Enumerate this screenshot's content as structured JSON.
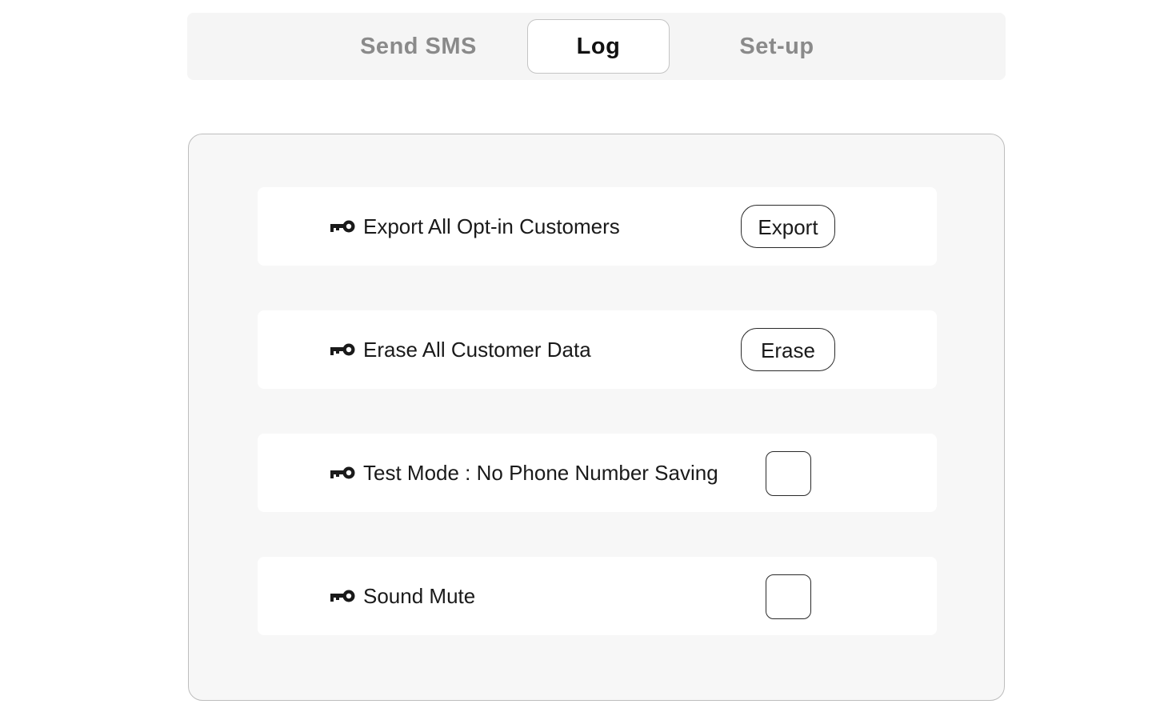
{
  "tabs": [
    {
      "label": "Send SMS",
      "active": false
    },
    {
      "label": "Log",
      "active": true
    },
    {
      "label": "Set-up",
      "active": false
    }
  ],
  "settings": {
    "rows": [
      {
        "icon": "key-icon",
        "label": "Export All Opt-in Customers",
        "control": "button",
        "button_label": "Export"
      },
      {
        "icon": "key-icon",
        "label": "Erase All Customer Data",
        "control": "button",
        "button_label": "Erase"
      },
      {
        "icon": "key-icon",
        "label": "Test Mode : No Phone Number Saving",
        "control": "checkbox",
        "checked": false
      },
      {
        "icon": "key-icon",
        "label": "Sound Mute",
        "control": "checkbox",
        "checked": false
      }
    ]
  },
  "colors": {
    "tabbar_bg": "#f5f5f5",
    "panel_bg": "#f7f7f7",
    "inactive_tab_text": "#8a8a8a",
    "active_tab_text": "#111111"
  }
}
